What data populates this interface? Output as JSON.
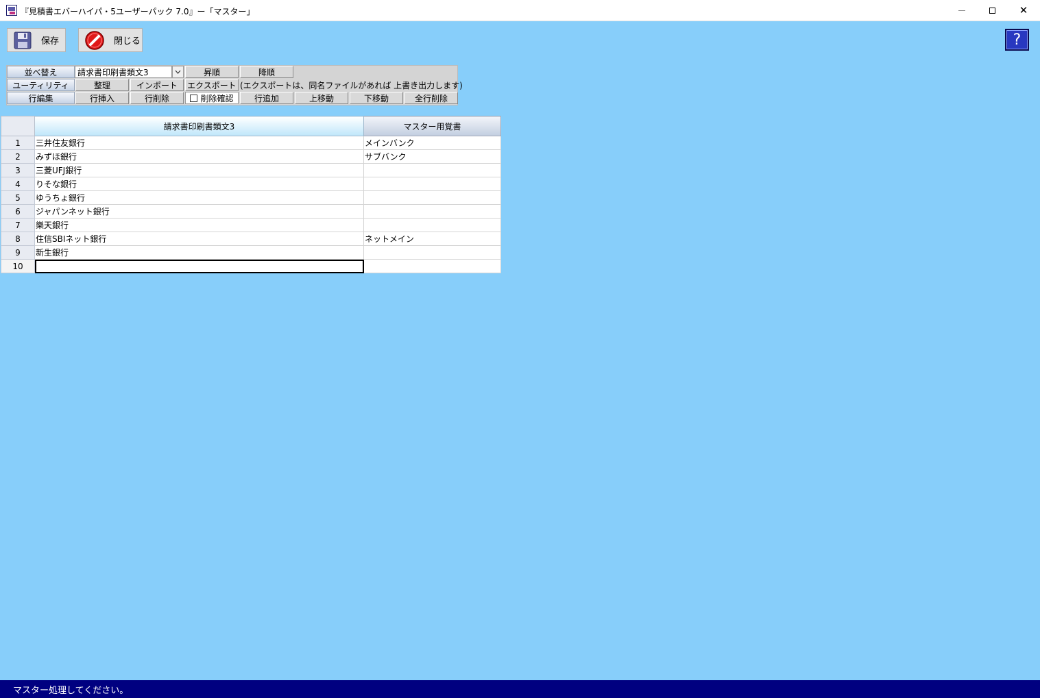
{
  "window": {
    "title": "『見積書エバーハイパ・5ユーザーパック 7.0』ー「マスター」",
    "minimize": "—",
    "maximize": "□",
    "close": "✕"
  },
  "toolbar": {
    "save_label": "保存",
    "close_label": "閉じる",
    "help_label": "?"
  },
  "panel": {
    "sort": {
      "label": "並べ替え",
      "selected": "請求書印刷書類文3",
      "asc": "昇順",
      "desc": "降順"
    },
    "utility": {
      "label": "ユーティリティ",
      "organize": "整理",
      "import": "インポート",
      "export": "エクスポート",
      "note": "(エクスポートは、同名ファイルがあれば 上書き出力します)"
    },
    "row_edit": {
      "label": "行編集",
      "insert": "行挿入",
      "delete": "行削除",
      "confirm_delete": "削除確認",
      "confirm_delete_checked": false,
      "add": "行追加",
      "move_up": "上移動",
      "move_down": "下移動",
      "delete_all": "全行削除"
    }
  },
  "grid": {
    "columns": [
      "請求書印刷書類文3",
      "マスター用覚書"
    ],
    "rows": [
      {
        "num": "1",
        "text": "三井住友銀行",
        "memo": "メインバンク"
      },
      {
        "num": "2",
        "text": "みずほ銀行",
        "memo": "サブバンク"
      },
      {
        "num": "3",
        "text": "三菱UFJ銀行",
        "memo": ""
      },
      {
        "num": "4",
        "text": "りそな銀行",
        "memo": ""
      },
      {
        "num": "5",
        "text": "ゆうちょ銀行",
        "memo": ""
      },
      {
        "num": "6",
        "text": "ジャパンネット銀行",
        "memo": ""
      },
      {
        "num": "7",
        "text": "樂天銀行",
        "memo": ""
      },
      {
        "num": "8",
        "text": "住信SBIネット銀行",
        "memo": "ネットメイン"
      },
      {
        "num": "9",
        "text": "新生銀行",
        "memo": ""
      },
      {
        "num": "10",
        "text": "",
        "memo": ""
      }
    ]
  },
  "status": {
    "message": "マスター処理してください。"
  },
  "colors": {
    "background": "#87cefa",
    "statusbar": "#000080"
  },
  "icons": {
    "save": "floppy-disk-icon",
    "close": "no-entry-icon",
    "help": "question-mark-icon",
    "app": "app-icon"
  }
}
